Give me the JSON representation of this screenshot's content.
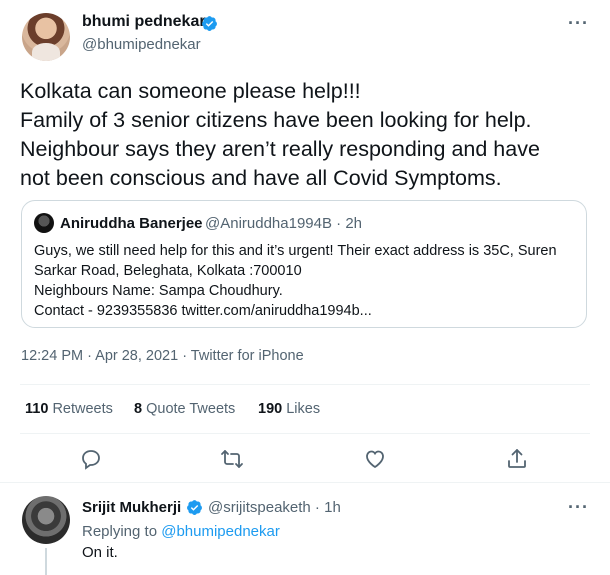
{
  "tweet": {
    "author_name": "bhumi pednekar",
    "author_handle": "@bhumipednekar",
    "text_lines": [
      "Kolkata can someone please help!!!",
      "Family of 3 senior citizens have been looking for help.",
      "Neighbour says they aren’t really responding and have",
      "not been conscious and have all Covid Symptoms."
    ],
    "quote": {
      "author_name": "Aniruddha Banerjee",
      "author_handle_time": "@Aniruddha1994B · 2h",
      "text_lines": [
        "Guys, we still need help for this and it’s urgent! Their exact address is 35C, Suren",
        "Sarkar Road, Beleghata, Kolkata :700010",
        "Neighbours Name: Sampa Choudhury.",
        "Contact - 9239355836 twitter.com/aniruddha1994b..."
      ]
    },
    "meta": "12:24 PM · Apr 28, 2021 · Twitter for iPhone",
    "stats": {
      "retweets_count": "110",
      "retweets_label": "Retweets",
      "quotes_count": "8",
      "quotes_label": "Quote Tweets",
      "likes_count": "190",
      "likes_label": "Likes"
    },
    "actions": [
      "reply-icon",
      "retweet-icon",
      "like-icon",
      "share-icon"
    ]
  },
  "reply": {
    "author_name": "Srijit Mukherji",
    "author_handle_time": "@srijitspeaketh · 1h",
    "replying_prefix": "Replying to",
    "replying_mention": "@bhumipednekar",
    "text": "On it."
  },
  "colors": {
    "text_primary": "#0f1419",
    "text_secondary": "#536471",
    "accent": "#1d9bf0",
    "border": "#cfd9de"
  }
}
